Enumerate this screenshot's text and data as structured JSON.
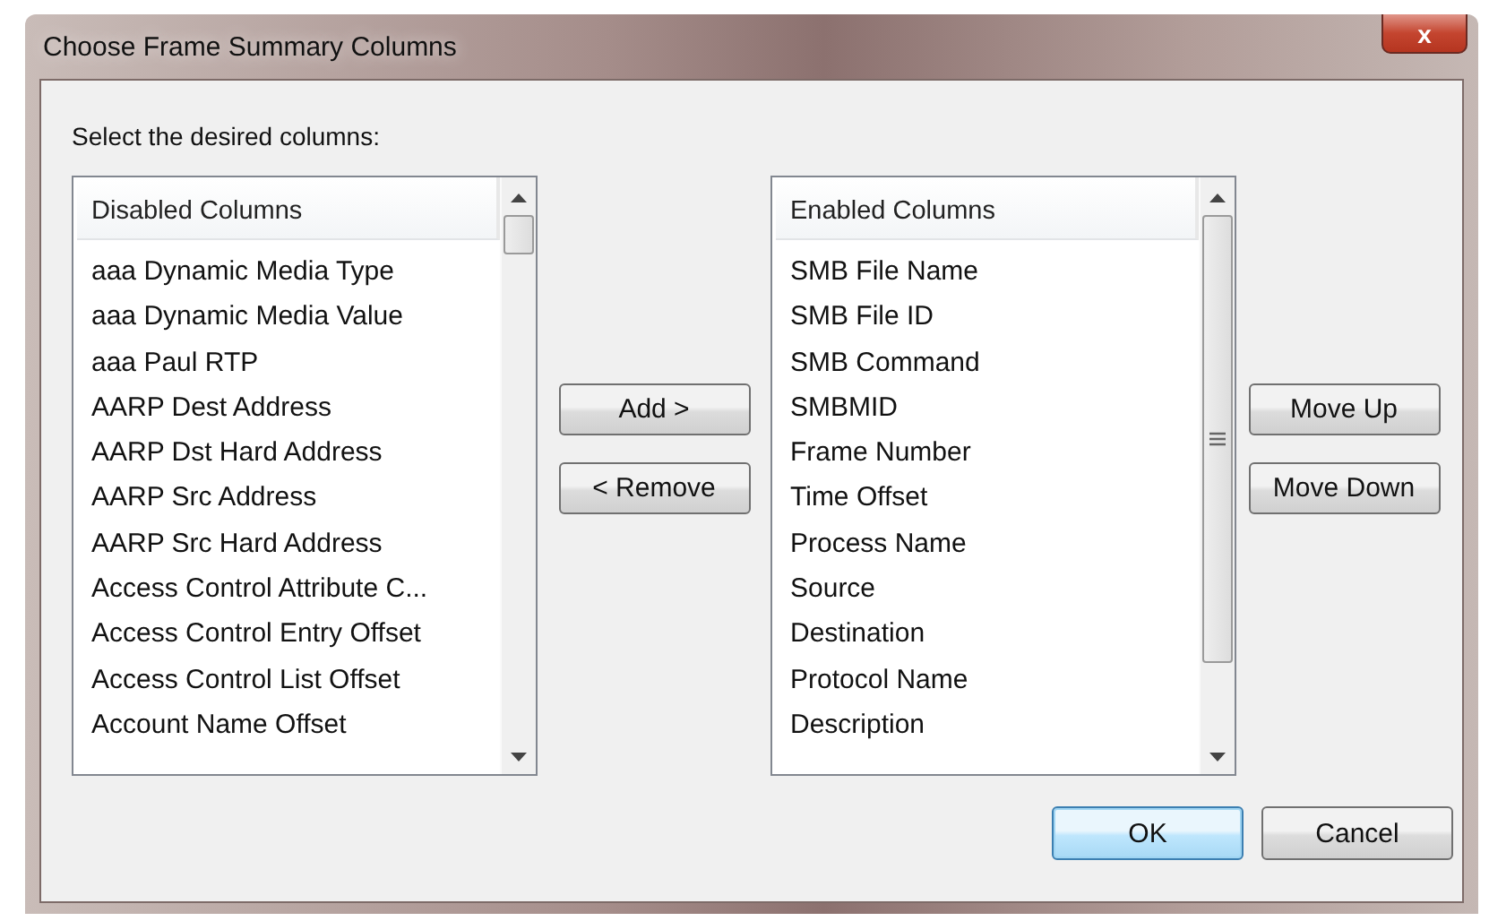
{
  "window": {
    "title": "Choose Frame Summary Columns",
    "close_label": "x"
  },
  "instruction": "Select the desired columns:",
  "disabled_list": {
    "header": "Disabled Columns",
    "items": [
      "aaa Dynamic Media Type",
      "aaa Dynamic Media Value",
      "aaa Paul RTP",
      "AARP Dest Address",
      "AARP Dst Hard Address",
      "AARP Src Address",
      "AARP Src Hard Address",
      "Access Control Attribute C...",
      "Access Control Entry Offset",
      "Access Control List Offset",
      "Account Name Offset"
    ]
  },
  "transfer_buttons": [
    "Add >",
    "< Remove"
  ],
  "enabled_list": {
    "header": "Enabled Columns",
    "items": [
      "SMB File Name",
      "SMB File ID",
      "SMB Command",
      "SMBMID",
      "Frame Number",
      "Time Offset",
      "Process Name",
      "Source",
      "Destination",
      "Protocol Name",
      "Description"
    ]
  },
  "order_buttons": [
    "Move Up",
    "Move Down"
  ],
  "dialog_buttons": [
    {
      "label": "OK",
      "default": true
    },
    {
      "label": "Cancel",
      "default": false
    }
  ]
}
